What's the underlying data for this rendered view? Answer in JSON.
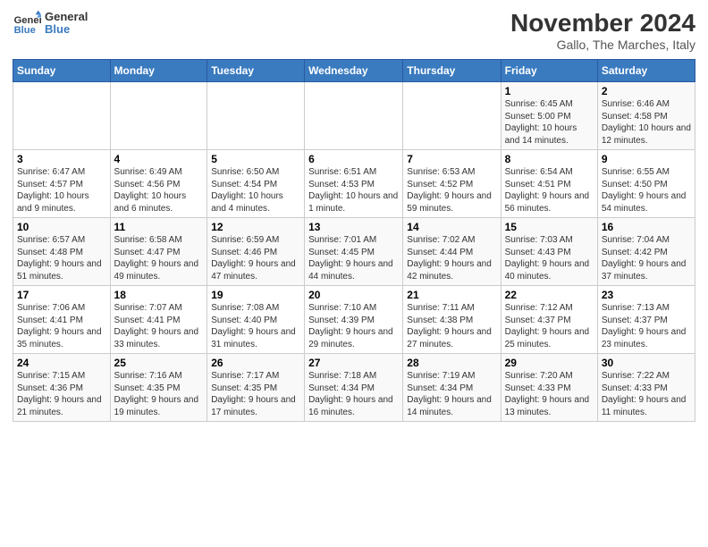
{
  "logo": {
    "text_general": "General",
    "text_blue": "Blue"
  },
  "header": {
    "month_title": "November 2024",
    "location": "Gallo, The Marches, Italy"
  },
  "days_of_week": [
    "Sunday",
    "Monday",
    "Tuesday",
    "Wednesday",
    "Thursday",
    "Friday",
    "Saturday"
  ],
  "weeks": [
    [
      {
        "day": "",
        "info": ""
      },
      {
        "day": "",
        "info": ""
      },
      {
        "day": "",
        "info": ""
      },
      {
        "day": "",
        "info": ""
      },
      {
        "day": "",
        "info": ""
      },
      {
        "day": "1",
        "info": "Sunrise: 6:45 AM\nSunset: 5:00 PM\nDaylight: 10 hours and 14 minutes."
      },
      {
        "day": "2",
        "info": "Sunrise: 6:46 AM\nSunset: 4:58 PM\nDaylight: 10 hours and 12 minutes."
      }
    ],
    [
      {
        "day": "3",
        "info": "Sunrise: 6:47 AM\nSunset: 4:57 PM\nDaylight: 10 hours and 9 minutes."
      },
      {
        "day": "4",
        "info": "Sunrise: 6:49 AM\nSunset: 4:56 PM\nDaylight: 10 hours and 6 minutes."
      },
      {
        "day": "5",
        "info": "Sunrise: 6:50 AM\nSunset: 4:54 PM\nDaylight: 10 hours and 4 minutes."
      },
      {
        "day": "6",
        "info": "Sunrise: 6:51 AM\nSunset: 4:53 PM\nDaylight: 10 hours and 1 minute."
      },
      {
        "day": "7",
        "info": "Sunrise: 6:53 AM\nSunset: 4:52 PM\nDaylight: 9 hours and 59 minutes."
      },
      {
        "day": "8",
        "info": "Sunrise: 6:54 AM\nSunset: 4:51 PM\nDaylight: 9 hours and 56 minutes."
      },
      {
        "day": "9",
        "info": "Sunrise: 6:55 AM\nSunset: 4:50 PM\nDaylight: 9 hours and 54 minutes."
      }
    ],
    [
      {
        "day": "10",
        "info": "Sunrise: 6:57 AM\nSunset: 4:48 PM\nDaylight: 9 hours and 51 minutes."
      },
      {
        "day": "11",
        "info": "Sunrise: 6:58 AM\nSunset: 4:47 PM\nDaylight: 9 hours and 49 minutes."
      },
      {
        "day": "12",
        "info": "Sunrise: 6:59 AM\nSunset: 4:46 PM\nDaylight: 9 hours and 47 minutes."
      },
      {
        "day": "13",
        "info": "Sunrise: 7:01 AM\nSunset: 4:45 PM\nDaylight: 9 hours and 44 minutes."
      },
      {
        "day": "14",
        "info": "Sunrise: 7:02 AM\nSunset: 4:44 PM\nDaylight: 9 hours and 42 minutes."
      },
      {
        "day": "15",
        "info": "Sunrise: 7:03 AM\nSunset: 4:43 PM\nDaylight: 9 hours and 40 minutes."
      },
      {
        "day": "16",
        "info": "Sunrise: 7:04 AM\nSunset: 4:42 PM\nDaylight: 9 hours and 37 minutes."
      }
    ],
    [
      {
        "day": "17",
        "info": "Sunrise: 7:06 AM\nSunset: 4:41 PM\nDaylight: 9 hours and 35 minutes."
      },
      {
        "day": "18",
        "info": "Sunrise: 7:07 AM\nSunset: 4:41 PM\nDaylight: 9 hours and 33 minutes."
      },
      {
        "day": "19",
        "info": "Sunrise: 7:08 AM\nSunset: 4:40 PM\nDaylight: 9 hours and 31 minutes."
      },
      {
        "day": "20",
        "info": "Sunrise: 7:10 AM\nSunset: 4:39 PM\nDaylight: 9 hours and 29 minutes."
      },
      {
        "day": "21",
        "info": "Sunrise: 7:11 AM\nSunset: 4:38 PM\nDaylight: 9 hours and 27 minutes."
      },
      {
        "day": "22",
        "info": "Sunrise: 7:12 AM\nSunset: 4:37 PM\nDaylight: 9 hours and 25 minutes."
      },
      {
        "day": "23",
        "info": "Sunrise: 7:13 AM\nSunset: 4:37 PM\nDaylight: 9 hours and 23 minutes."
      }
    ],
    [
      {
        "day": "24",
        "info": "Sunrise: 7:15 AM\nSunset: 4:36 PM\nDaylight: 9 hours and 21 minutes."
      },
      {
        "day": "25",
        "info": "Sunrise: 7:16 AM\nSunset: 4:35 PM\nDaylight: 9 hours and 19 minutes."
      },
      {
        "day": "26",
        "info": "Sunrise: 7:17 AM\nSunset: 4:35 PM\nDaylight: 9 hours and 17 minutes."
      },
      {
        "day": "27",
        "info": "Sunrise: 7:18 AM\nSunset: 4:34 PM\nDaylight: 9 hours and 16 minutes."
      },
      {
        "day": "28",
        "info": "Sunrise: 7:19 AM\nSunset: 4:34 PM\nDaylight: 9 hours and 14 minutes."
      },
      {
        "day": "29",
        "info": "Sunrise: 7:20 AM\nSunset: 4:33 PM\nDaylight: 9 hours and 13 minutes."
      },
      {
        "day": "30",
        "info": "Sunrise: 7:22 AM\nSunset: 4:33 PM\nDaylight: 9 hours and 11 minutes."
      }
    ]
  ]
}
